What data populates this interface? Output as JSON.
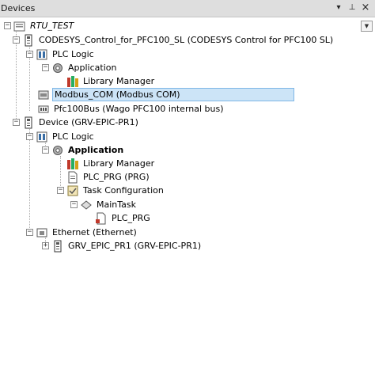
{
  "panel": {
    "title": "Devices",
    "menu_glyph": "▾",
    "pin_glyph": "⊥",
    "close_glyph": "×",
    "dropdown_glyph": "▼"
  },
  "tree": {
    "root": "RTU_TEST",
    "dev1": "CODESYS_Control_for_PFC100_SL (CODESYS Control for PFC100 SL)",
    "dev1_plc": "PLC Logic",
    "dev1_app": "Application",
    "dev1_lib": "Library Manager",
    "modbus": "Modbus_COM (Modbus COM)",
    "pfcbus": "Pfc100Bus (Wago PFC100 internal bus)",
    "dev2": "Device (GRV-EPIC-PR1)",
    "dev2_plc": "PLC Logic",
    "dev2_app": "Application",
    "dev2_lib": "Library Manager",
    "plc_prg": "PLC_PRG (PRG)",
    "task_cfg": "Task Configuration",
    "main_task": "MainTask",
    "task_plc_prg": "PLC_PRG",
    "ethernet": "Ethernet (Ethernet)",
    "grv": "GRV_EPIC_PR1 (GRV-EPIC-PR1)"
  },
  "expanders": {
    "open": "−",
    "closed": "+"
  },
  "colors": {
    "selection_bg": "#cce4f7",
    "selection_border": "#7fb7e6",
    "header_bg": "#dedede"
  }
}
